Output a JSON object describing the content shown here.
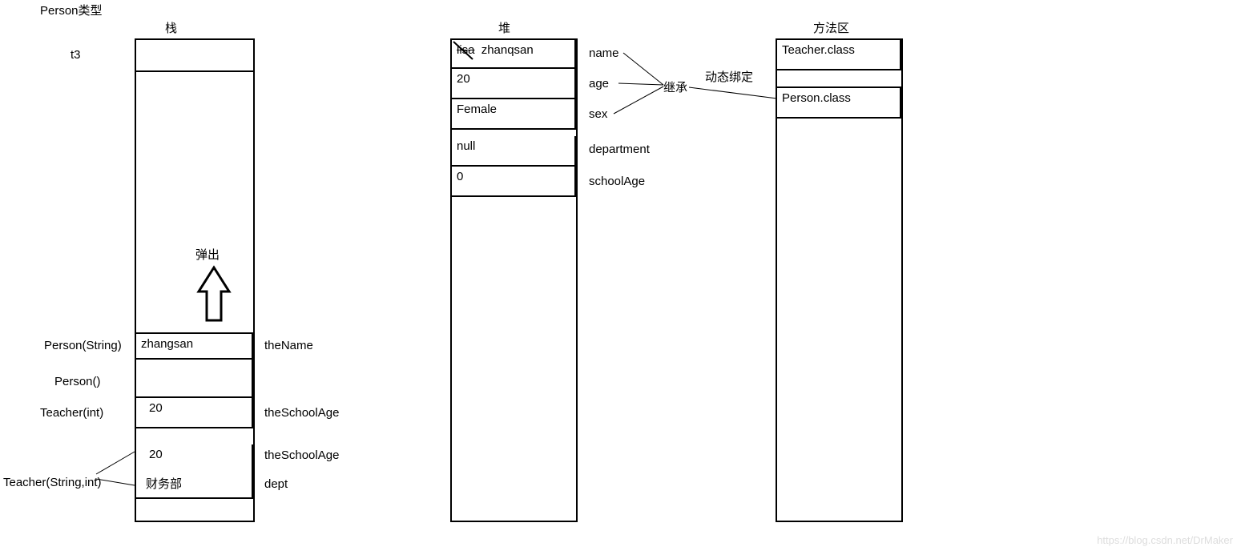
{
  "title": "Person类型",
  "columns": {
    "stack": {
      "header": "栈"
    },
    "heap": {
      "header": "堆"
    },
    "method": {
      "header": "方法区"
    }
  },
  "stack": {
    "var_t3": "t3",
    "pop_label": "弹出",
    "rows": {
      "personString": {
        "left": "Person(String)",
        "cell": "zhangsan",
        "right": "theName"
      },
      "personNoArg": {
        "left": "Person()"
      },
      "teacherInt": {
        "left": "Teacher(int)",
        "cell": "20",
        "right": "theSchoolAge"
      },
      "teacherStrInt": {
        "left": "Teacher(String,int)",
        "row1": {
          "cell": "20",
          "right": "theSchoolAge"
        },
        "row2": {
          "cell": "财务部",
          "right": "dept"
        }
      }
    }
  },
  "heap": {
    "obj": {
      "name": {
        "old": "lisa",
        "new": "zhanqsan",
        "label": "name"
      },
      "age": {
        "value": "20",
        "label": "age"
      },
      "sex": {
        "value": "Female",
        "label": "sex"
      },
      "department": {
        "value": "null",
        "label": "department"
      },
      "schoolAge": {
        "value": "0",
        "label": "schoolAge"
      }
    },
    "inherit_label": "继承",
    "dynbind_label": "动态绑定"
  },
  "method_area": {
    "teacher": "Teacher.class",
    "person": "Person.class"
  },
  "watermark": "https://blog.csdn.net/DrMaker"
}
